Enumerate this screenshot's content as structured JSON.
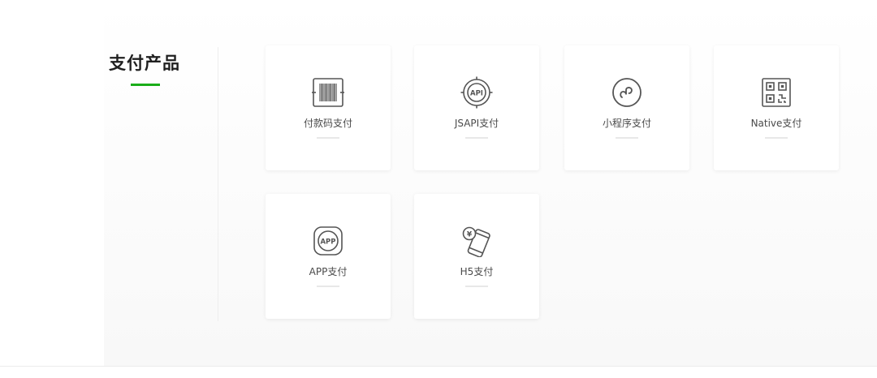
{
  "section": {
    "title": "支付产品"
  },
  "products": [
    {
      "label": "付款码支付",
      "icon": "barcode-icon"
    },
    {
      "label": "JSAPI支付",
      "icon": "api-icon"
    },
    {
      "label": "小程序支付",
      "icon": "mini-program-icon"
    },
    {
      "label": "Native支付",
      "icon": "qrcode-icon"
    },
    {
      "label": "APP支付",
      "icon": "app-icon"
    },
    {
      "label": "H5支付",
      "icon": "h5-phone-icon"
    }
  ],
  "icon_texts": {
    "api": "API",
    "app": "APP",
    "yen": "¥"
  },
  "colors": {
    "accent": "#1aad19",
    "icon_stroke": "#555555",
    "title": "#1f1f1f",
    "label": "#4a4a4a"
  }
}
